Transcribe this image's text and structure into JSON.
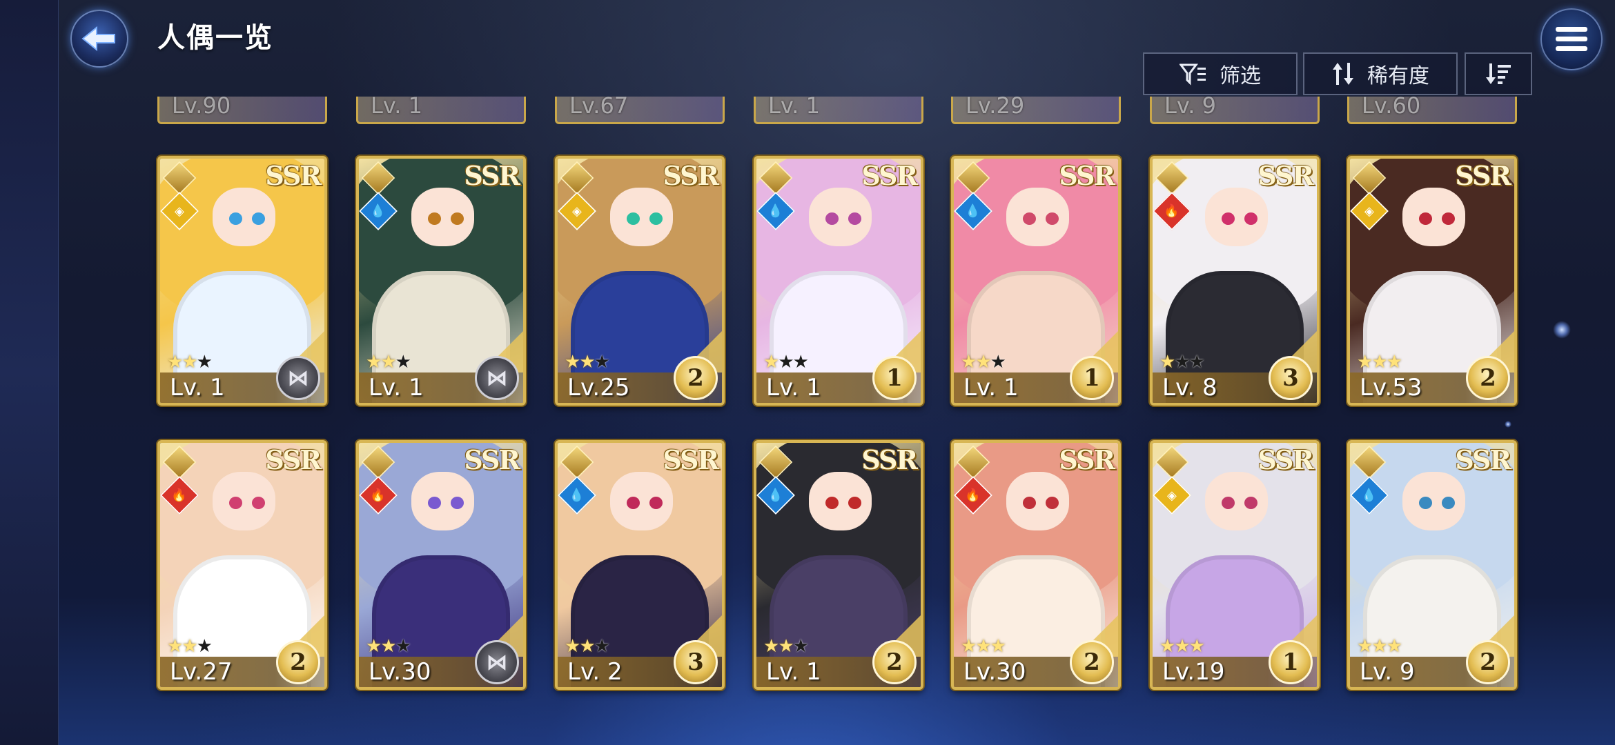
{
  "header": {
    "title": "人偶一览",
    "back_icon": "back-arrow-icon",
    "menu_icon": "hamburger-menu-icon"
  },
  "toolbar": {
    "filter_label": "筛选",
    "rarity_label": "稀有度",
    "filter_icon": "filter-icon",
    "sort_icon": "sort-arrows-icon",
    "order_icon": "descending-order-icon"
  },
  "partial_row": [
    "Lv.90",
    "Lv. 1",
    "Lv.67",
    "Lv. 1",
    "Lv.29",
    "Lv. 9",
    "Lv.60"
  ],
  "cards": [
    {
      "rarity": "SSR",
      "level": "Lv. 1",
      "element": "light",
      "stars": 2,
      "badge": "butterfly",
      "hair": "#f5c64a",
      "outfit": "#eaf4ff",
      "eye": "#3aa0e0"
    },
    {
      "rarity": "SSR",
      "level": "Lv. 1",
      "element": "water",
      "stars": 2,
      "badge": "butterfly",
      "hair": "#2c4a3e",
      "outfit": "#e9e4d4",
      "eye": "#c07a20"
    },
    {
      "rarity": "SSR",
      "level": "Lv.25",
      "element": "light",
      "stars": 2,
      "badge": "2",
      "hair": "#c99a5a",
      "outfit": "#2a3f9a",
      "eye": "#2cbfa0"
    },
    {
      "rarity": "SSR",
      "level": "Lv. 1",
      "element": "water",
      "stars": 1,
      "badge": "1",
      "hair": "#e7b6e3",
      "outfit": "#f6f1ff",
      "eye": "#b44aa0"
    },
    {
      "rarity": "SSR",
      "level": "Lv. 1",
      "element": "water",
      "stars": 2,
      "badge": "1",
      "hair": "#f08aa6",
      "outfit": "#f6d8c8",
      "eye": "#d04a6a"
    },
    {
      "rarity": "SSR",
      "level": "Lv. 8",
      "element": "fire",
      "stars": 1,
      "badge": "3",
      "hair": "#f1eef2",
      "outfit": "#2b2b33",
      "eye": "#d0306a"
    },
    {
      "rarity": "SSR",
      "level": "Lv.53",
      "element": "light",
      "stars": 3,
      "badge": "2",
      "hair": "#4a2a22",
      "outfit": "#f2eef0",
      "eye": "#c0283a"
    },
    {
      "rarity": "SSR",
      "level": "Lv.27",
      "element": "fire",
      "stars": 2,
      "badge": "2",
      "hair": "#f4d3b8",
      "outfit": "#ffffff",
      "eye": "#d04070"
    },
    {
      "rarity": "SSR",
      "level": "Lv.30",
      "element": "fire",
      "stars": 2,
      "badge": "butterfly",
      "hair": "#9aa8d6",
      "outfit": "#3a2f7a",
      "eye": "#7a5ad0"
    },
    {
      "rarity": "SSR",
      "level": "Lv. 2",
      "element": "water",
      "stars": 2,
      "badge": "3",
      "hair": "#f0c9a0",
      "outfit": "#2a2445",
      "eye": "#c02a5a"
    },
    {
      "rarity": "SSR",
      "level": "Lv. 1",
      "element": "water",
      "stars": 2,
      "badge": "2",
      "hair": "#2a2a30",
      "outfit": "#4a3f66",
      "eye": "#c02a2a"
    },
    {
      "rarity": "SSR",
      "level": "Lv.30",
      "element": "fire",
      "stars": 3,
      "badge": "2",
      "hair": "#e99a86",
      "outfit": "#fbeee2",
      "eye": "#c0303a"
    },
    {
      "rarity": "SSR",
      "level": "Lv.19",
      "element": "light",
      "stars": 3,
      "badge": "1",
      "hair": "#e4e2ea",
      "outfit": "#c7a6e6",
      "eye": "#c03a6a"
    },
    {
      "rarity": "SSR",
      "level": "Lv. 9",
      "element": "water",
      "stars": 3,
      "badge": "2",
      "hair": "#c6d8ee",
      "outfit": "#f4f2ee",
      "eye": "#3a8ac0"
    }
  ]
}
